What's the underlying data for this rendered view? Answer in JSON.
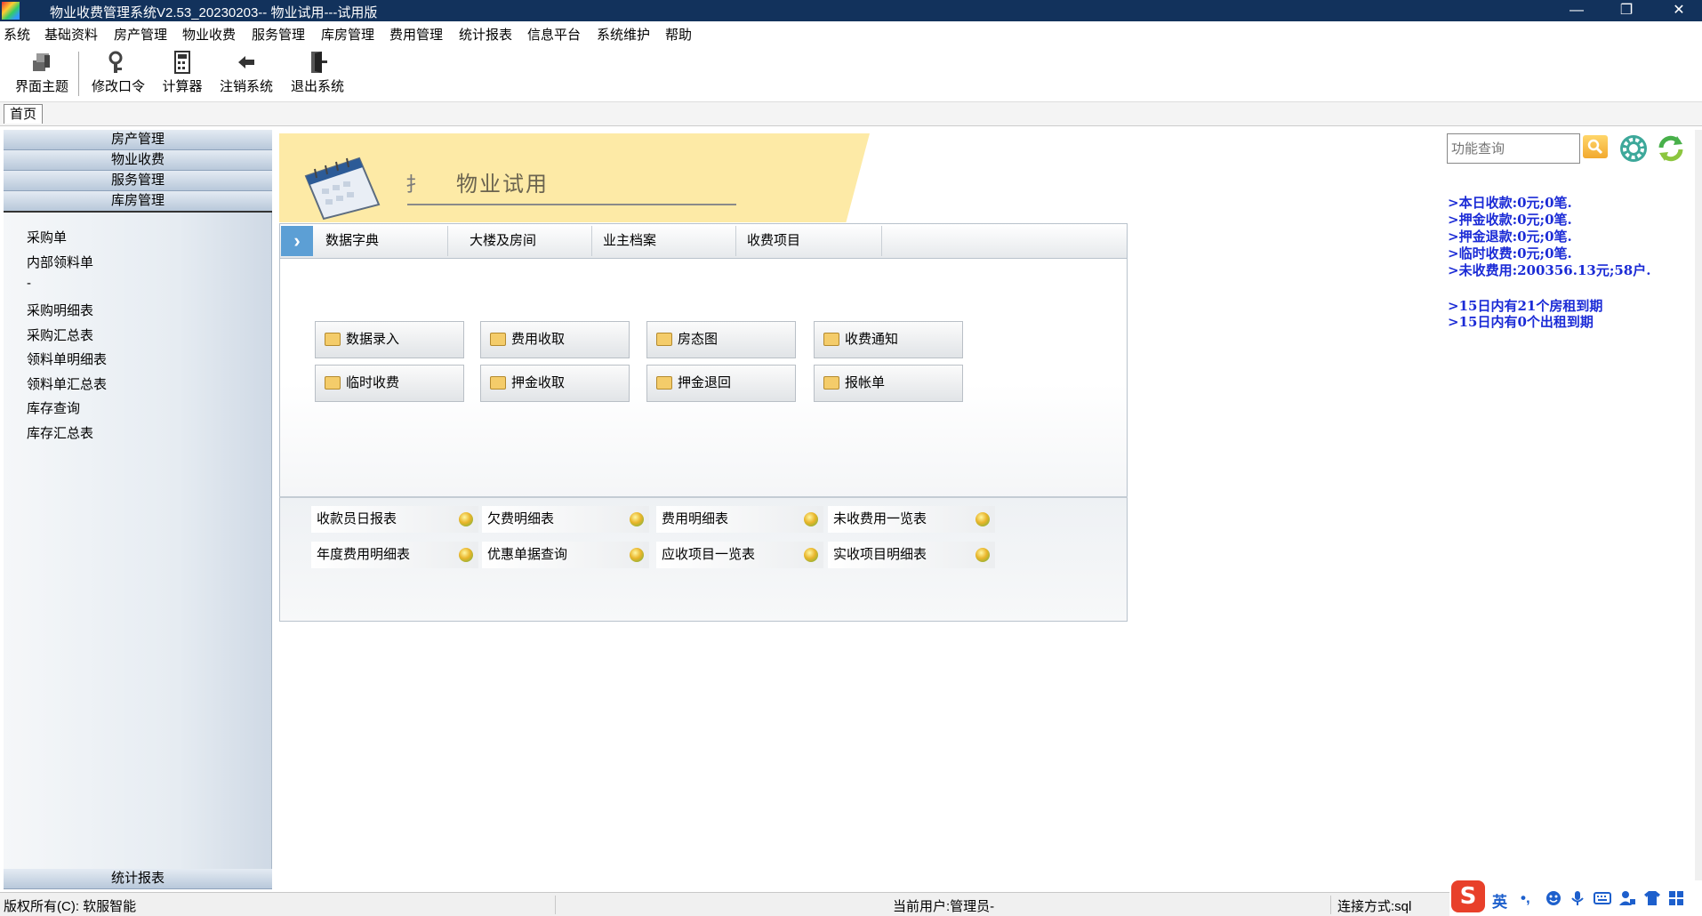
{
  "window": {
    "title": "物业收费管理系统V2.53_20230203--      物业试用---试用版",
    "controls": {
      "minimize": "—",
      "restore": "❐",
      "close": "✕"
    }
  },
  "menu": [
    "系统",
    "基础资料",
    "房产管理",
    "物业收费",
    "服务管理",
    "库房管理",
    "费用管理",
    "统计报表",
    "信息平台",
    "系统维护",
    "帮助"
  ],
  "toolbar": {
    "buttons": [
      {
        "label": "界面主题",
        "icon": "theme-icon"
      },
      {
        "label": "修改口令",
        "icon": "key-icon"
      },
      {
        "label": "计算器",
        "icon": "calculator-icon"
      },
      {
        "label": "注销系统",
        "icon": "logout-arrow-icon"
      },
      {
        "label": "退出系统",
        "icon": "exit-door-icon"
      }
    ]
  },
  "tabs": {
    "home": "首页"
  },
  "sidebar": {
    "headers": [
      "房产管理",
      "物业收费",
      "服务管理",
      "库房管理"
    ],
    "items": [
      "采购单",
      "内部领料单",
      "-",
      "采购明细表",
      "采购汇总表",
      "领料单明细表",
      "领料单汇总表",
      "库存查询",
      "库存汇总表"
    ],
    "bottom_header": "统计报表"
  },
  "banner": {
    "title": "物业试用",
    "glyph": "扌"
  },
  "subtabs": [
    "数据字典",
    "大楼及房间",
    "业主档案",
    "收费项目"
  ],
  "function_buttons": [
    [
      "数据录入",
      "费用收取",
      "房态图",
      "收费通知"
    ],
    [
      "临时收费",
      "押金收取",
      "押金退回",
      "报帐单"
    ]
  ],
  "report_links": [
    [
      "收款员日报表",
      "欠费明细表",
      "费用明细表",
      "未收费用一览表"
    ],
    [
      "年度费用明细表",
      "优惠单据查询",
      "应收项目一览表",
      "实收项目明细表"
    ]
  ],
  "search": {
    "placeholder": "功能查询"
  },
  "stats": [
    ">本日收款:0元;0笔.",
    ">押金收款:0元;0笔.",
    ">押金退款:0元;0笔.",
    ">临时收费:0元;0笔.",
    ">未收费用:200356.13元;58户.",
    ">15日内有21个房租到期",
    ">15日内有0个出租到期"
  ],
  "status": {
    "copyright": "版权所有(C): 软服智能",
    "current_user": "当前用户:管理员-",
    "connection": "连接方式:sql"
  },
  "ime": {
    "logo": "S",
    "lang": "英",
    "punct": "•,",
    "items": [
      "emoji-icon",
      "mic-icon",
      "keyboard-icon",
      "user-icon",
      "shirt-icon",
      "grid-icon"
    ]
  },
  "colors": {
    "titlebar": "#12325c",
    "stats_text": "#1b2bd6",
    "banner": "#fdeaa6",
    "tab_arrow": "#5c9fd5"
  }
}
